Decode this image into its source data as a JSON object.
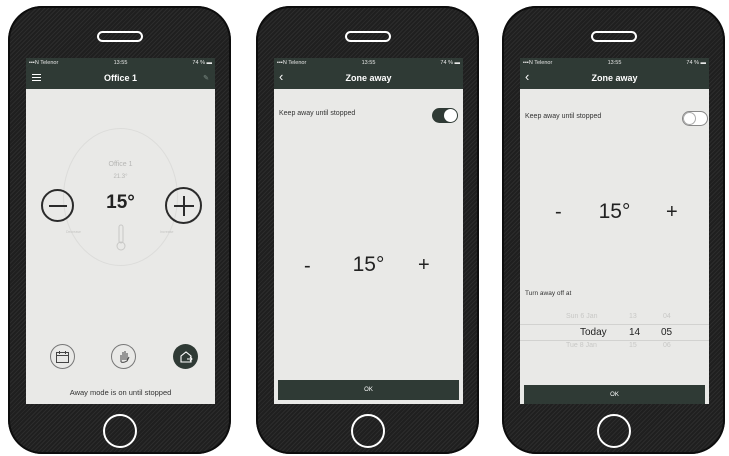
{
  "colors": {
    "header": "#2f3a35",
    "screen_bg": "#e9e9e7",
    "phone_body": "#1f1f1f",
    "toggle_on": "#2f3a35"
  },
  "status": {
    "carrier": "N Telenor",
    "time": "13:55",
    "battery": "74 %"
  },
  "screen1": {
    "title": "Office 1",
    "zone_name": "Office 1",
    "current_temp": "21.3°",
    "setpoint": "15°",
    "decrease_label": "Decrease",
    "increase_label": "Increase",
    "away_message": "Away mode is on until stopped",
    "icons": [
      "menu-icon",
      "edit-icon",
      "minus-icon",
      "plus-icon",
      "thermometer-icon",
      "calendar-icon",
      "hand-icon",
      "away-home-icon"
    ]
  },
  "screen2": {
    "back": "‹",
    "title": "Zone away",
    "keep_away_label": "Keep away until stopped",
    "toggle_on": true,
    "minus": "-",
    "setpoint": "15°",
    "plus": "+",
    "ok": "OK"
  },
  "screen3": {
    "back": "‹",
    "title": "Zone away",
    "keep_away_label": "Keep away until stopped",
    "toggle_on": false,
    "minus": "-",
    "setpoint": "15°",
    "plus": "+",
    "turn_away_label": "Turn away off at",
    "picker": {
      "prev": {
        "day": "Sun 6 Jan",
        "hour": "13",
        "minute": "04"
      },
      "selected": {
        "day": "Today",
        "hour": "14",
        "minute": "05"
      },
      "next": {
        "day": "Tue 8 Jan",
        "hour": "15",
        "minute": "06"
      }
    },
    "ok": "OK"
  }
}
